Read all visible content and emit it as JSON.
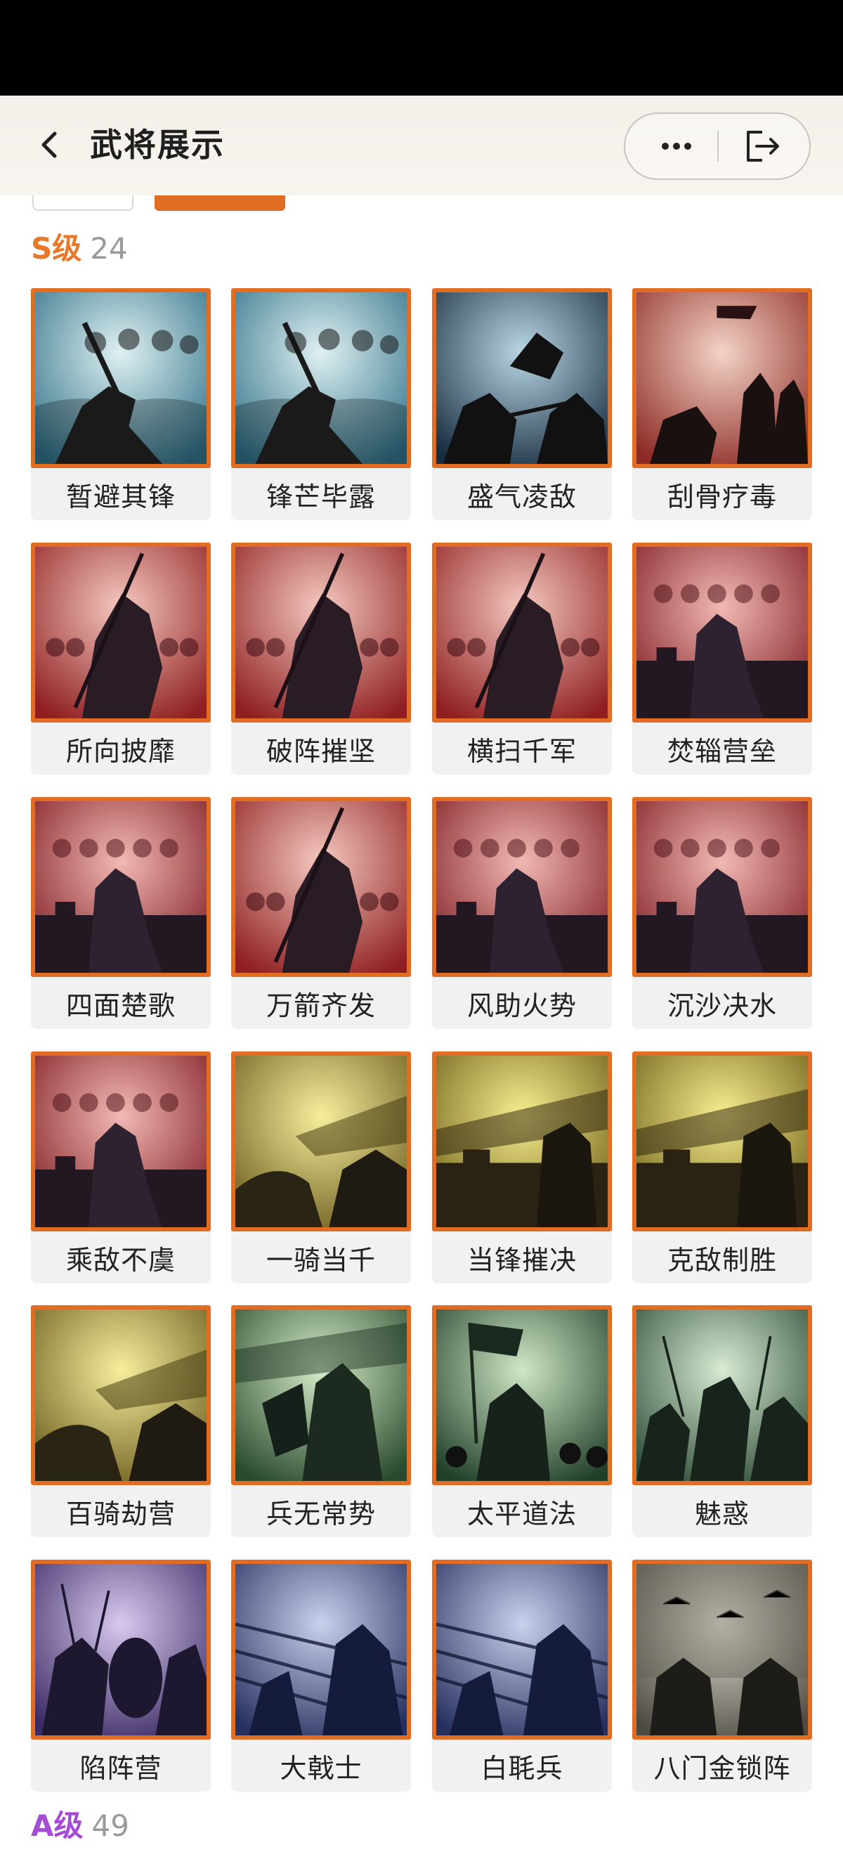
{
  "nav": {
    "title": "武将展示"
  },
  "sections": [
    {
      "grade": "S级",
      "count": "24"
    },
    {
      "grade": "A级",
      "count": "49"
    }
  ],
  "cards": [
    {
      "name": "暂避其锋",
      "art": "sky-slash"
    },
    {
      "name": "锋芒毕露",
      "art": "sky-slash"
    },
    {
      "name": "盛气凌敌",
      "art": "night-duel"
    },
    {
      "name": "刮骨疗毒",
      "art": "red-camp"
    },
    {
      "name": "所向披靡",
      "art": "red-rider"
    },
    {
      "name": "破阵摧坚",
      "art": "red-rider"
    },
    {
      "name": "横扫千军",
      "art": "red-rider"
    },
    {
      "name": "焚辎营垒",
      "art": "red-fort"
    },
    {
      "name": "四面楚歌",
      "art": "red-fort"
    },
    {
      "name": "万箭齐发",
      "art": "red-rider"
    },
    {
      "name": "风助火势",
      "art": "red-fort"
    },
    {
      "name": "沉沙决水",
      "art": "red-fort"
    },
    {
      "name": "乘敌不虞",
      "art": "red-fort"
    },
    {
      "name": "一骑当千",
      "art": "gold-charge"
    },
    {
      "name": "当锋摧决",
      "art": "gold-wall"
    },
    {
      "name": "克敌制胜",
      "art": "gold-wall"
    },
    {
      "name": "百骑劫营",
      "art": "gold-charge"
    },
    {
      "name": "兵无常势",
      "art": "green-strategist"
    },
    {
      "name": "太平道法",
      "art": "green-banner"
    },
    {
      "name": "魅惑",
      "art": "green-troops"
    },
    {
      "name": "陷阵营",
      "art": "purple-shield"
    },
    {
      "name": "大戟士",
      "art": "blue-pikes"
    },
    {
      "name": "白毦兵",
      "art": "blue-pikes"
    },
    {
      "name": "八门金锁阵",
      "art": "stone-council"
    }
  ],
  "art_palettes": {
    "sky-slash": [
      "#dff1f3",
      "#2f6f85"
    ],
    "night-duel": [
      "#b9d6e4",
      "#162c40"
    ],
    "red-camp": [
      "#f4d3c6",
      "#8c2a25"
    ],
    "red-rider": [
      "#f5c9bf",
      "#8f1f22"
    ],
    "red-fort": [
      "#f2b9b4",
      "#7e1a20"
    ],
    "gold-charge": [
      "#f6ef9c",
      "#6b5a1e"
    ],
    "gold-wall": [
      "#f7ee8f",
      "#6d5d17"
    ],
    "green-strategist": [
      "#d5ecc9",
      "#294a2c"
    ],
    "green-banner": [
      "#cfe7c5",
      "#21402a"
    ],
    "green-troops": [
      "#d8ebd3",
      "#2c4b37"
    ],
    "purple-shield": [
      "#d8c9ef",
      "#3b2a63"
    ],
    "blue-pikes": [
      "#c9d1ec",
      "#26305e"
    ],
    "stone-council": [
      "#e2dfd6",
      "#4d4a42"
    ]
  },
  "icons": {
    "back": "chevron-left-icon",
    "more": "more-dots-icon",
    "exit": "exit-icon"
  }
}
